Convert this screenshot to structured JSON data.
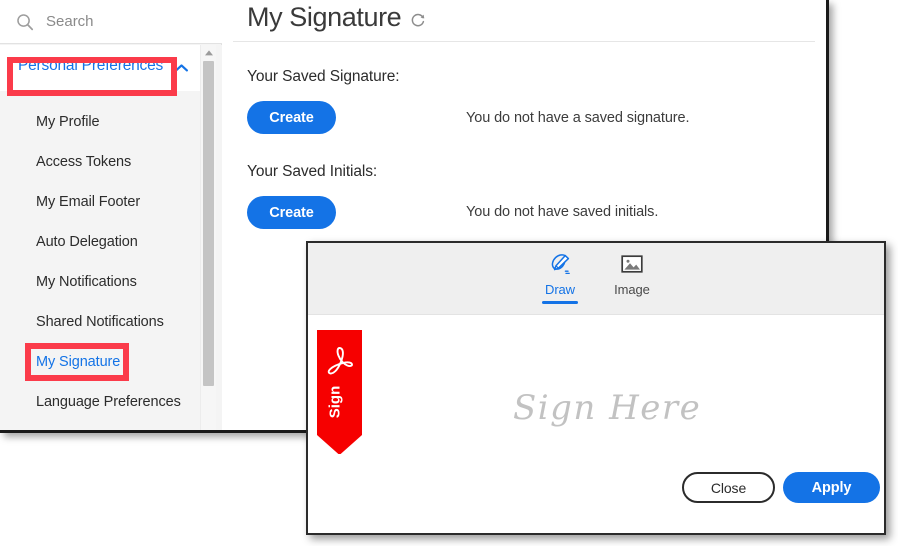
{
  "search": {
    "placeholder": "Search",
    "value": "",
    "icon": "search-icon"
  },
  "sidebar": {
    "group": {
      "label": "Personal Preferences",
      "expanded": true,
      "chevron_icon": "chevron-up-icon",
      "accent_color": "#1473e6"
    },
    "items": [
      {
        "label": "My Profile",
        "selected": false
      },
      {
        "label": "Access Tokens",
        "selected": false
      },
      {
        "label": "My Email Footer",
        "selected": false
      },
      {
        "label": "Auto Delegation",
        "selected": false
      },
      {
        "label": "My Notifications",
        "selected": false
      },
      {
        "label": "Shared Notifications",
        "selected": false
      },
      {
        "label": "My Signature",
        "selected": true
      },
      {
        "label": "Language Preferences",
        "selected": false
      }
    ],
    "scrollbar": {
      "up_arrow_icon": "caret-up-icon",
      "thumb": "scroll-thumb"
    }
  },
  "main": {
    "title": "My Signature",
    "refresh_icon": "refresh-icon",
    "sections": [
      {
        "label": "Your Saved Signature:",
        "button_label": "Create",
        "status": "You do not have a saved signature."
      },
      {
        "label": "Your Saved Initials:",
        "button_label": "Create",
        "status": "You do not have saved initials."
      }
    ]
  },
  "dialog": {
    "tabs": [
      {
        "label": "Draw",
        "icon": "pen-nib-icon",
        "active": true
      },
      {
        "label": "Image",
        "icon": "picture-icon",
        "active": false
      }
    ],
    "canvas": {
      "placeholder": "Sign Here",
      "sign_tag_label": "Sign",
      "sign_tag_icon": "adobe-acrobat-logo-icon",
      "sign_tag_color": "#f60000",
      "line_color": "#2b7fd6"
    },
    "buttons": {
      "close_label": "Close",
      "apply_label": "Apply"
    }
  },
  "annotations": {
    "color": "#fb3b4a",
    "boxes": [
      {
        "target": "Personal Preferences"
      },
      {
        "target": "My Signature"
      }
    ]
  }
}
